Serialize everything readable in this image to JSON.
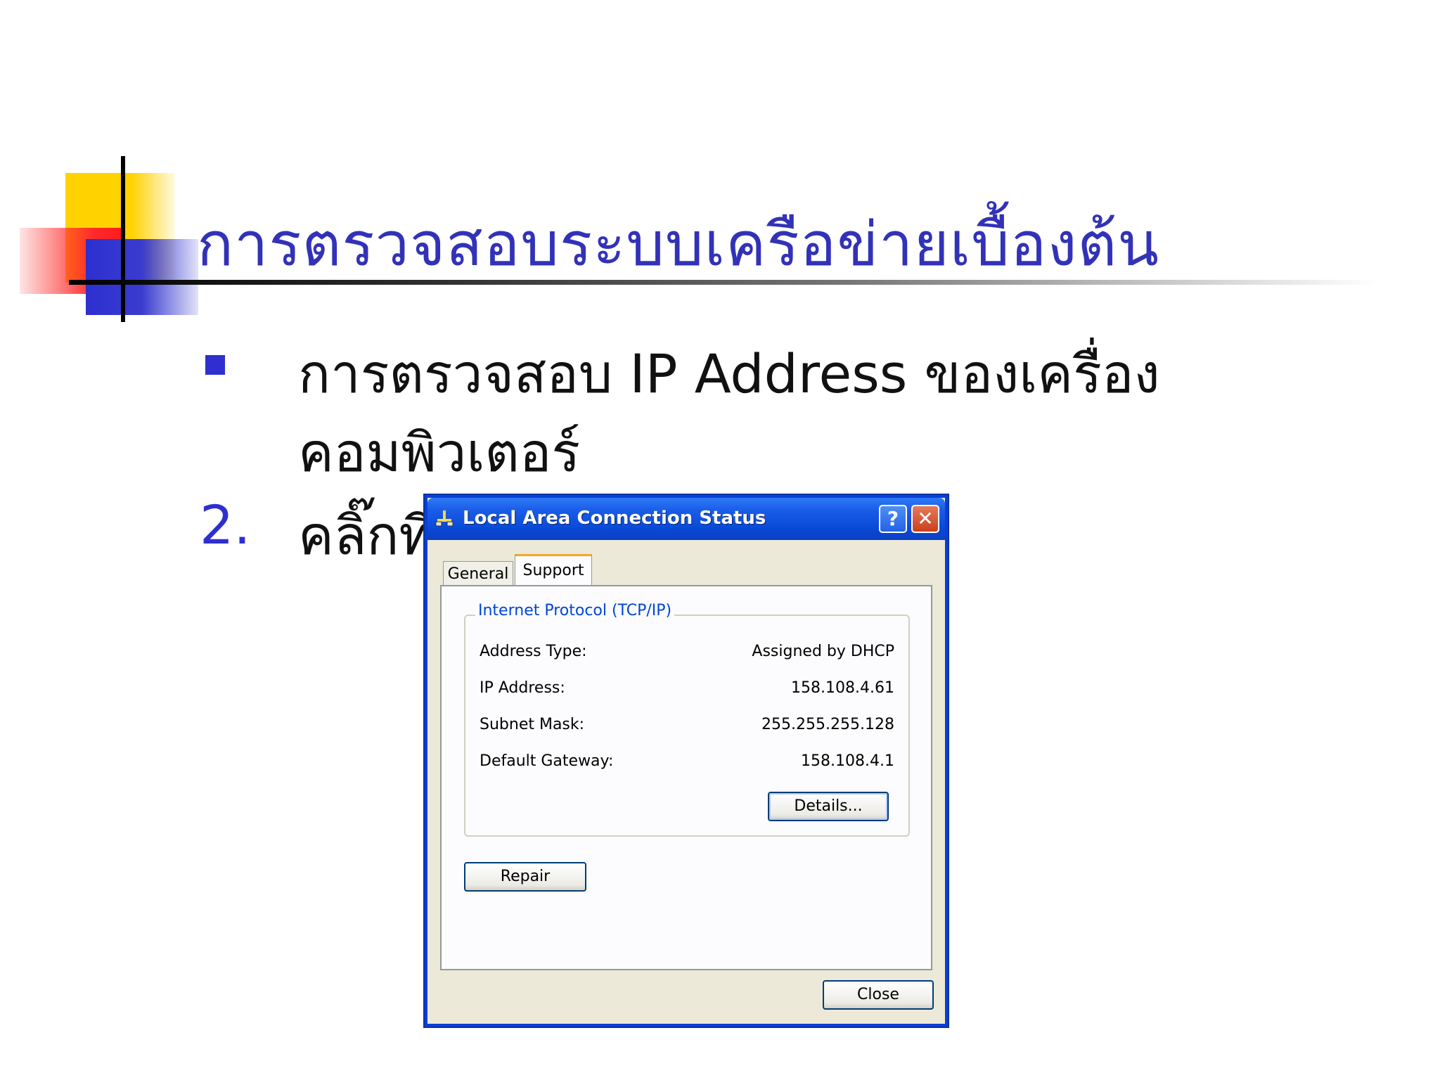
{
  "slide": {
    "title": "การตรวจสอบระบบเครือข่ายเบื้องต้น",
    "bullet_line1": "การตรวจสอบ IP Address ของเครื่อง",
    "bullet_line2": "คอมพิวเตอร์",
    "step_number": "2.",
    "step_text": "คลิ๊กที่"
  },
  "dialog": {
    "title": "Local Area Connection Status",
    "help_label": "?",
    "close_x_label": "✕",
    "tabs": [
      {
        "label": "General",
        "active": false
      },
      {
        "label": "Support",
        "active": true
      }
    ],
    "group_title": "Internet Protocol (TCP/IP)",
    "rows": [
      {
        "label": "Address Type:",
        "value": "Assigned by DHCP"
      },
      {
        "label": "IP Address:",
        "value": "158.108.4.61"
      },
      {
        "label": "Subnet Mask:",
        "value": "255.255.255.128"
      },
      {
        "label": "Default Gateway:",
        "value": "158.108.4.1"
      }
    ],
    "details_button": "Details...",
    "repair_button": "Repair",
    "close_button": "Close"
  },
  "colors": {
    "title_blue": "#3232b8",
    "bullet_blue": "#2f2fd0",
    "xp_titlebar": "#0a4ad8",
    "dialog_bg": "#ece9d8"
  }
}
